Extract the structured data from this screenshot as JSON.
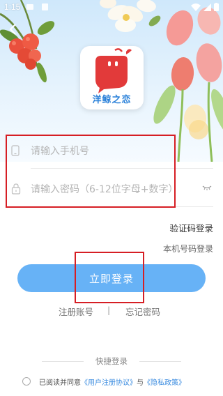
{
  "status_bar": {
    "time": "1:15"
  },
  "logo": {
    "app_name": "洋鲸之恋"
  },
  "form": {
    "phone_placeholder": "请输入手机号",
    "password_placeholder": "请输入密码（6-12位字母+数字）"
  },
  "links": {
    "sms_login": "验证码登录",
    "phone_login": "本机号码登录",
    "register": "注册账号",
    "separator": "|",
    "forgot_password": "忘记密码"
  },
  "login_button": {
    "label": "立即登录"
  },
  "quick_login": {
    "label": "快捷登录"
  },
  "agreement": {
    "prefix": "已阅读并同意",
    "user_agreement": "《用户注册协议》",
    "and": "与",
    "privacy_policy": "《隐私政策》"
  },
  "colors": {
    "primary": "#67b2f6",
    "highlight": "#d61e24",
    "link": "#3d8de0"
  }
}
